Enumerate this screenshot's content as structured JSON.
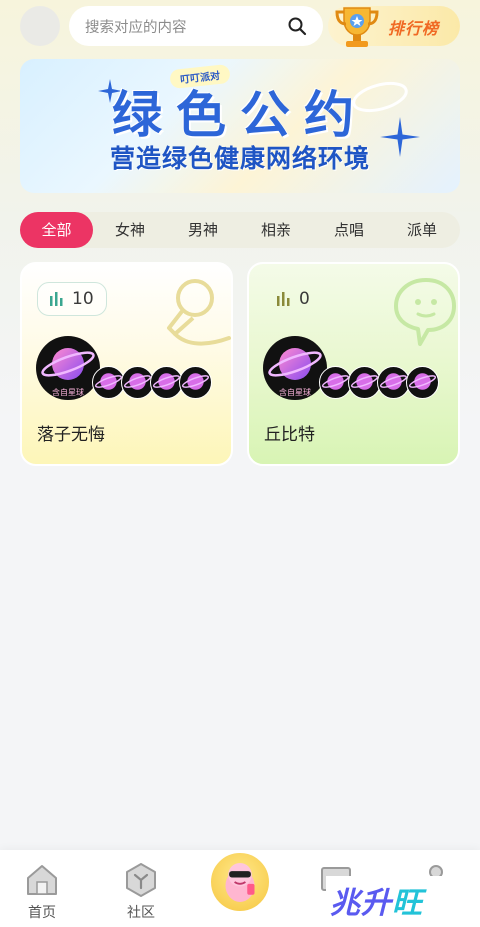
{
  "search": {
    "placeholder": "搜索对应的内容"
  },
  "ranking": {
    "label": "排行榜"
  },
  "banner": {
    "tag": "叮叮派对",
    "title": "绿色公约",
    "subtitle": "营造绿色健康网络环境"
  },
  "tabs": [
    {
      "label": "全部",
      "active": true
    },
    {
      "label": "女神"
    },
    {
      "label": "男神"
    },
    {
      "label": "相亲"
    },
    {
      "label": "点唱"
    },
    {
      "label": "派单"
    }
  ],
  "rooms": [
    {
      "name": "落子无悔",
      "count": "10",
      "host_caption": "含自星球",
      "icon": "microphone-icon"
    },
    {
      "name": "丘比特",
      "count": "0",
      "host_caption": "含自星球",
      "icon": "chat-bubble-icon"
    }
  ],
  "bottom_nav": [
    {
      "label": "首页",
      "icon": "home-icon"
    },
    {
      "label": "社区",
      "icon": "community-icon"
    },
    {
      "label": "",
      "icon": "party-mascot-icon"
    },
    {
      "label": "",
      "icon": "message-icon"
    },
    {
      "label": "",
      "icon": "profile-icon"
    }
  ],
  "watermark": {
    "text_part1": "兆升",
    "text_part2": "旺"
  },
  "colors": {
    "accent_pink": "#ec3464",
    "ranking_orange": "#f06a24",
    "banner_blue": "#2d66d8",
    "card_yellow": "#fdf6b8",
    "card_green": "#d8f4b4"
  }
}
